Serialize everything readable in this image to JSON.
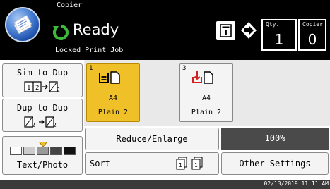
{
  "header": {
    "app_title": "Copier",
    "status": "Ready",
    "sub_status": "Locked Print Job",
    "qty_label": "Qty.",
    "qty_value": "1",
    "copies_label": "Copier",
    "copies_value": "0"
  },
  "duplex": {
    "sim_to_dup": "Sim to Dup",
    "dup_to_dup": "Dup to Dup"
  },
  "original_type": {
    "label": "Text/Photo",
    "density_level": 3,
    "density_steps": 5
  },
  "trays": [
    {
      "number": "1",
      "size": "A4",
      "paper_type": "Plain 2",
      "selected": true
    },
    {
      "number": "3",
      "size": "A4",
      "paper_type": "Plain 2",
      "selected": false
    }
  ],
  "reduce_enlarge": {
    "label": "Reduce/Enlarge",
    "value": "100%"
  },
  "sort": {
    "label": "Sort"
  },
  "other_settings": {
    "label": "Other Settings"
  },
  "footer": {
    "datetime": "02/13/2019 11:11 AM"
  },
  "colors": {
    "selected_tray": "#f0c028",
    "status_icon": "#3cba3c",
    "tray_alert_icon": "#d42020",
    "zoom_bg": "#4a4a4a"
  }
}
